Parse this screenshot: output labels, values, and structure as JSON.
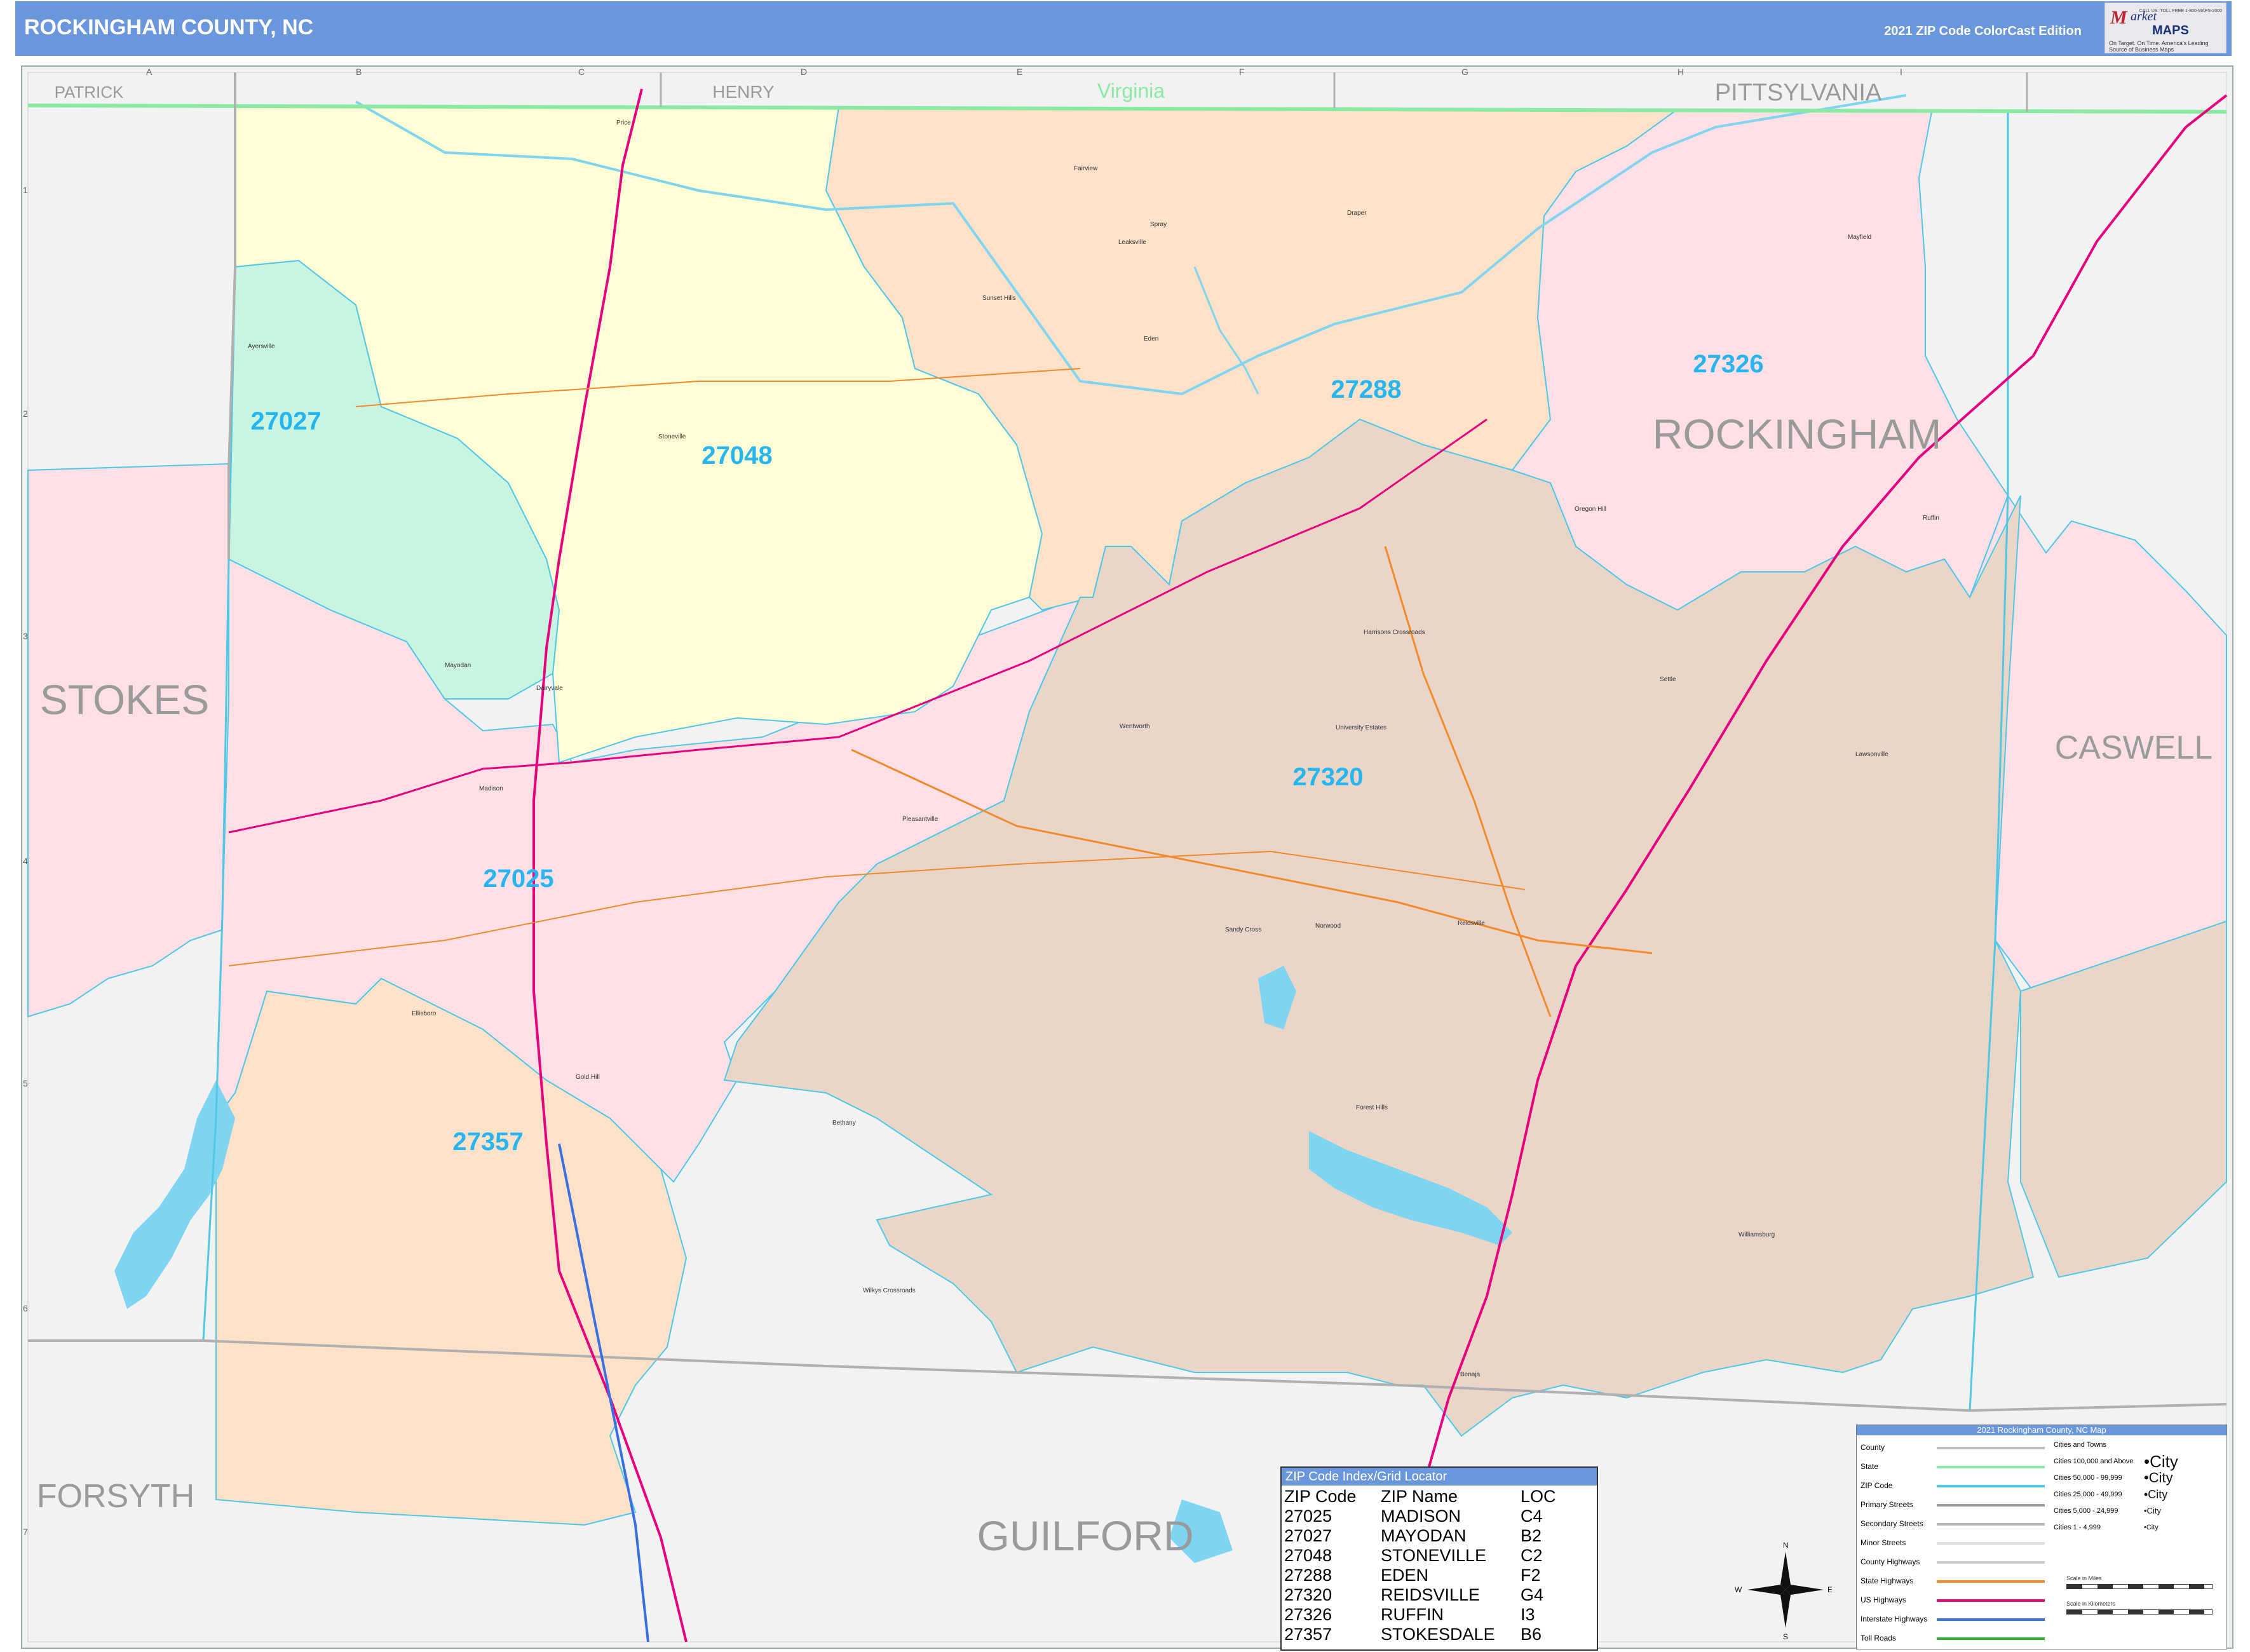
{
  "header": {
    "title": "ROCKINGHAM COUNTY, NC",
    "edition": "2021 ZIP Code ColorCast Edition",
    "logo": {
      "brand_m": "M",
      "brand_rest": "arket",
      "brand_maps": "MAPS",
      "tagline": "On Target. On Time. America's Leading Source of Business Maps",
      "contact": "CALL US: TOLL FREE 1-800-MAPS-2000"
    }
  },
  "map": {
    "grid_columns": [
      "A",
      "B",
      "C",
      "D",
      "E",
      "F",
      "G",
      "H",
      "I"
    ],
    "grid_rows": [
      "1",
      "2",
      "3",
      "4",
      "5",
      "6",
      "7"
    ],
    "state_label": "Virginia",
    "neighbor_counties": [
      "PATRICK",
      "HENRY",
      "PITTSYLVANIA",
      "STOKES",
      "CASWELL",
      "FORSYTH",
      "GUILFORD"
    ],
    "county_label": "ROCKINGHAM",
    "zip_labels": [
      "27027",
      "27048",
      "27288",
      "27326",
      "27320",
      "27025",
      "27357"
    ],
    "places": [
      "Price",
      "Fairview",
      "Draper",
      "Spray",
      "Leaksville",
      "Mayfield",
      "Sunset Hills",
      "Eden",
      "Ayersville",
      "Stoneville",
      "Oregon Hill",
      "Ruffin",
      "Harrisons Crossroads",
      "Mayodan",
      "Dairyvale",
      "Madison",
      "Wentworth",
      "University Estates",
      "Settle",
      "Lawsonville",
      "Pleasantville",
      "Sandy Cross",
      "Norwood",
      "Reidsville",
      "Ellisboro",
      "Gold Hill",
      "Bethany",
      "Forest Hills",
      "Williamsburg",
      "Wilkys Crossroads",
      "Benaja"
    ],
    "compass": [
      "N",
      "S",
      "E",
      "W"
    ],
    "colors": {
      "z27027": "#c8f5e2",
      "z27048": "#fffdd5",
      "z27288": "#fde1c8",
      "z27326": "#fde0e6",
      "z27320": "#e9d6c8",
      "z27025": "#fde0e6",
      "z27357": "#fde1c8",
      "outside": "#f2f2f2",
      "water": "#7fd4f0",
      "zip_border": "#4fc7e6",
      "zip_label": "#26b5ee",
      "us_highway": "#e6007e",
      "state_highway": "#f08a2a",
      "interstate": "#3a6fe0",
      "state_line": "#8aeaa4"
    }
  },
  "zip_index": {
    "caption": "ZIP Code Index/Grid Locator",
    "columns": [
      "ZIP Code",
      "ZIP Name",
      "LOC"
    ],
    "rows": [
      [
        "27025",
        "MADISON",
        "C4"
      ],
      [
        "27027",
        "MAYODAN",
        "B2"
      ],
      [
        "27048",
        "STONEVILLE",
        "C2"
      ],
      [
        "27288",
        "EDEN",
        "F2"
      ],
      [
        "27320",
        "REIDSVILLE",
        "G4"
      ],
      [
        "27326",
        "RUFFIN",
        "I3"
      ],
      [
        "27357",
        "STOKESDALE",
        "B6"
      ]
    ]
  },
  "legend": {
    "caption": "2021 Rockingham County, NC Map",
    "items": [
      {
        "label": "County",
        "color": "#bdbdbd"
      },
      {
        "label": "State",
        "color": "#8aeaa4"
      },
      {
        "label": "ZIP Code",
        "color": "#4fc7e6"
      },
      {
        "label": "Primary Streets",
        "color": "#9a9a9a"
      },
      {
        "label": "Secondary Streets",
        "color": "#b8b8b8"
      },
      {
        "label": "Minor Streets",
        "color": "#dddddd"
      },
      {
        "label": "County Highways",
        "color": "#cccccc"
      },
      {
        "label": "State Highways",
        "color": "#f08a2a"
      },
      {
        "label": "US Highways",
        "color": "#e6007e"
      },
      {
        "label": "Interstate Highways",
        "color": "#3a6fe0"
      },
      {
        "label": "Toll Roads",
        "color": "#2fb52f"
      }
    ],
    "cities_heading": "Cities and Towns",
    "cities": [
      {
        "label": "Cities 100,000 and Above",
        "symbol": "•City"
      },
      {
        "label": "Cities 50,000 - 99,999",
        "symbol": "•City"
      },
      {
        "label": "Cities 25,000 - 49,999",
        "symbol": "•City"
      },
      {
        "label": "Cities 5,000 - 24,999",
        "symbol": "•City"
      },
      {
        "label": "Cities 1 - 4,999",
        "symbol": "•City"
      }
    ],
    "scale_miles": "Scale in Miles",
    "scale_km": "Scale in Kilometers"
  }
}
